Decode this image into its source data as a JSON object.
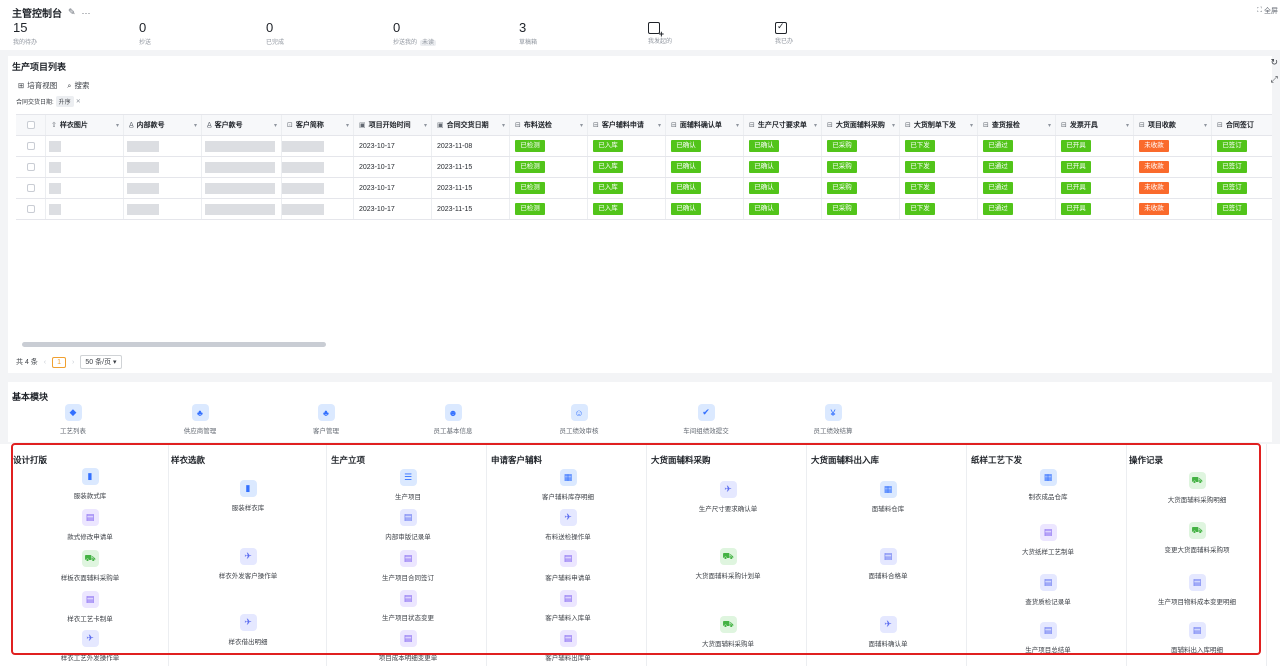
{
  "header": {
    "title": "主管控制台",
    "fullscreen_label": "全屏"
  },
  "stats": [
    {
      "value": "15",
      "label": "我的待办"
    },
    {
      "value": "0",
      "label": "抄送"
    },
    {
      "value": "0",
      "label": "已完成"
    },
    {
      "value": "0",
      "label": "抄送我的",
      "tag": "未读"
    },
    {
      "value": "3",
      "label": "草稿箱"
    },
    {
      "icon": "add-note-icon",
      "label": "我发起的"
    },
    {
      "icon": "checkbox-icon",
      "label": "我已办"
    }
  ],
  "production_list": {
    "title": "生产项目列表",
    "toolbar": [
      "培育视图",
      "搜索"
    ],
    "filter": {
      "field": "合同交货日期:",
      "value": "升序"
    },
    "columns": [
      "样衣图片",
      "内部款号",
      "客户款号",
      "客户简称",
      "项目开始时间",
      "合同交货日期",
      "布料送检",
      "客户辅料申请",
      "面辅料确认单",
      "生产尺寸要求单",
      "大货面辅料采购",
      "大货制单下发",
      "查货报检",
      "发票开具",
      "项目收款",
      "合同签订"
    ],
    "rows": [
      {
        "start": "2023-10-17",
        "delivery": "2023-11-08",
        "statuses": [
          "已检测",
          "已入库",
          "已确认",
          "已确认",
          "已采购",
          "已下发",
          "已通过",
          "已开具",
          "未收款",
          "已签订"
        ]
      },
      {
        "start": "2023-10-17",
        "delivery": "2023-11-15",
        "statuses": [
          "已检测",
          "已入库",
          "已确认",
          "已确认",
          "已采购",
          "已下发",
          "已通过",
          "已开具",
          "未收款",
          "已签订"
        ]
      },
      {
        "start": "2023-10-17",
        "delivery": "2023-11-15",
        "statuses": [
          "已检测",
          "已入库",
          "已确认",
          "已确认",
          "已采购",
          "已下发",
          "已通过",
          "已开具",
          "未收款",
          "已签订"
        ]
      },
      {
        "start": "2023-10-17",
        "delivery": "2023-11-15",
        "statuses": [
          "已检测",
          "已入库",
          "已确认",
          "已确认",
          "已采购",
          "已下发",
          "已通过",
          "已开具",
          "未收款",
          "已签订"
        ]
      }
    ],
    "pager": {
      "total": "共 4 条",
      "page": "1",
      "size": "50 条/页"
    }
  },
  "basic_modules": {
    "title": "基本模块",
    "items": [
      {
        "label": "工艺列表",
        "icon": "tag-icon"
      },
      {
        "label": "供应商管理",
        "icon": "hierarchy-icon"
      },
      {
        "label": "客户管理",
        "icon": "hierarchy-icon"
      },
      {
        "label": "员工基本信息",
        "icon": "team-icon"
      },
      {
        "label": "员工绩效审核",
        "icon": "user-star-icon"
      },
      {
        "label": "车间组绩效提交",
        "icon": "check-circle-icon"
      },
      {
        "label": "员工绩效结算",
        "icon": "money-icon"
      }
    ]
  },
  "categories": [
    {
      "title": "设计打版",
      "items": [
        {
          "label": "服装款式库",
          "icon": "doc-icon",
          "color": "blue"
        },
        {
          "label": "款式修改申请单",
          "icon": "clipboard-icon",
          "color": "purple"
        },
        {
          "label": "样板衣面辅料采购单",
          "icon": "cart-icon",
          "color": "green"
        },
        {
          "label": "样衣工艺卡制单",
          "icon": "clipboard-icon",
          "color": "purple"
        },
        {
          "label": "样衣工艺外发操作单",
          "icon": "plane-icon",
          "color": "indigo"
        }
      ]
    },
    {
      "title": "样衣选款",
      "items": [
        {
          "label": "服装样衣库",
          "icon": "doc-icon",
          "color": "blue"
        },
        {
          "label": "样衣外发客户操作单",
          "icon": "plane-icon",
          "color": "indigo"
        },
        {
          "label": "样衣借出明细",
          "icon": "plane-icon",
          "color": "indigo"
        }
      ]
    },
    {
      "title": "生产立项",
      "items": [
        {
          "label": "生产项目",
          "icon": "server-icon",
          "color": "blue"
        },
        {
          "label": "内部审版记录单",
          "icon": "file-icon",
          "color": "indigo"
        },
        {
          "label": "生产项目合同签订",
          "icon": "clipboard-icon",
          "color": "purple"
        },
        {
          "label": "生产项目状态变更",
          "icon": "clipboard-icon",
          "color": "purple"
        },
        {
          "label": "项目成本明细变更单",
          "icon": "file-icon",
          "color": "purple"
        }
      ]
    },
    {
      "title": "申请客户辅料",
      "items": [
        {
          "label": "客户辅料库存明细",
          "icon": "store-icon",
          "color": "blue"
        },
        {
          "label": "布料送检操作单",
          "icon": "plane-icon",
          "color": "indigo"
        },
        {
          "label": "客户辅料申请单",
          "icon": "clipboard-icon",
          "color": "purple"
        },
        {
          "label": "客户辅料入库单",
          "icon": "clipboard-icon",
          "color": "purple"
        },
        {
          "label": "客户辅料出库单",
          "icon": "file-icon",
          "color": "purple"
        }
      ]
    },
    {
      "title": "大货面辅料采购",
      "items": [
        {
          "label": "生产尺寸要求确认单",
          "icon": "plane-icon",
          "color": "indigo"
        },
        {
          "label": "大货面辅料采购计划单",
          "icon": "cart-icon",
          "color": "green"
        },
        {
          "label": "大货面辅料采购单",
          "icon": "cart-icon",
          "color": "green"
        }
      ]
    },
    {
      "title": "大货面辅料出入库",
      "items": [
        {
          "label": "面辅料仓库",
          "icon": "store-icon",
          "color": "blue"
        },
        {
          "label": "面辅料合格单",
          "icon": "file-icon",
          "color": "indigo"
        },
        {
          "label": "面辅料确认单",
          "icon": "plane-icon",
          "color": "indigo"
        }
      ]
    },
    {
      "title": "纸样工艺下发",
      "items": [
        {
          "label": "制衣成品仓库",
          "icon": "store-icon",
          "color": "blue"
        },
        {
          "label": "大货纸样工艺制单",
          "icon": "clipboard-icon",
          "color": "purple"
        },
        {
          "label": "查货质检记录单",
          "icon": "file-icon",
          "color": "indigo"
        },
        {
          "label": "生产项目总结单",
          "icon": "file-icon",
          "color": "indigo"
        }
      ]
    },
    {
      "title": "操作记录",
      "items": [
        {
          "label": "大货面辅料采购明细",
          "icon": "cart-icon",
          "color": "green"
        },
        {
          "label": "变更大货面辅料采购项",
          "icon": "cart-icon",
          "color": "green"
        },
        {
          "label": "生产项目物料成本变更明细",
          "icon": "file-icon",
          "color": "indigo"
        },
        {
          "label": "面辅料出入库明细",
          "icon": "file-icon",
          "color": "indigo"
        }
      ]
    }
  ]
}
